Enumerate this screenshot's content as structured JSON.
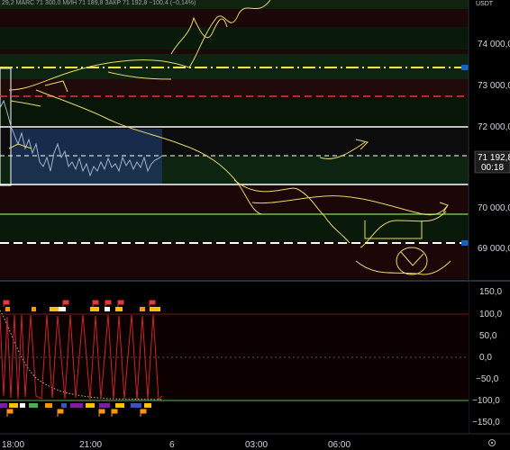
{
  "header": {
    "ohlc_text": "29,2 MARC 71 300,0 MИН 71 189,8 ЗАКР 71 192,8 −100,4 (−0,14%)",
    "currency": "USDT"
  },
  "price_axis": {
    "ticks": [
      "74 000,0",
      "73 000,0",
      "72 000,0",
      "70 000,0",
      "69 000,0"
    ],
    "last_price": "71 192,8",
    "countdown": "00:18"
  },
  "oscillator_axis": {
    "ticks": [
      "150,0",
      "100,0",
      "50,0",
      "0,0",
      "−50,0",
      "−100,0",
      "−150,0"
    ]
  },
  "time_axis": {
    "ticks": [
      "18:00",
      "21:00",
      "6",
      "03:00",
      "06:00"
    ]
  },
  "colors": {
    "background": "#000000",
    "yellow_level": "#f5e642",
    "red_level": "#e53935",
    "white_level": "#ffffff",
    "green_level": "#6cc24a",
    "osc_line": "#c62828",
    "drawing": "#e8d96a",
    "price_line": "#9fb3c8",
    "badge": "#1e1e1e",
    "green_zone": "#0c2410",
    "red_zone": "#2a0808",
    "blue_zone": "#1d3560"
  },
  "icons": {
    "settings": "gear-icon",
    "level_marker": "flag-icon"
  }
}
